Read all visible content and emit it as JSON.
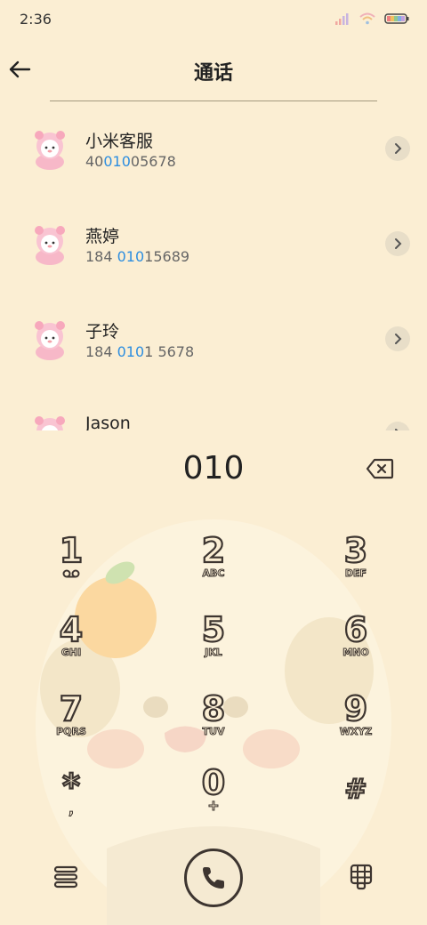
{
  "status": {
    "time": "2:36"
  },
  "header": {
    "title": "通话"
  },
  "contacts": [
    {
      "name": "小米客服",
      "num_pre": "40",
      "num_hl": "010",
      "num_post": "05678"
    },
    {
      "name": "燕婷",
      "num_pre": "184 ",
      "num_hl": "010",
      "num_post": "15689"
    },
    {
      "name": "子玲",
      "num_pre": "184 ",
      "num_hl": "010",
      "num_post": "1 5678"
    },
    {
      "name": "Jason",
      "num_pre": "",
      "num_hl": "",
      "num_post": ""
    }
  ],
  "dialer": {
    "input": "010",
    "keys": [
      {
        "digit": "1",
        "letters": ""
      },
      {
        "digit": "2",
        "letters": "ABC"
      },
      {
        "digit": "3",
        "letters": "DEF"
      },
      {
        "digit": "4",
        "letters": "GHI"
      },
      {
        "digit": "5",
        "letters": "JKL"
      },
      {
        "digit": "6",
        "letters": "MNO"
      },
      {
        "digit": "7",
        "letters": "PQRS"
      },
      {
        "digit": "8",
        "letters": "TUV"
      },
      {
        "digit": "9",
        "letters": "WXYZ"
      },
      {
        "digit": "*",
        "letters": ","
      },
      {
        "digit": "0",
        "letters": "+"
      },
      {
        "digit": "#",
        "letters": ""
      }
    ]
  },
  "colors": {
    "background": "#fbeed3",
    "highlight": "#2d8ee0",
    "ink": "#3d3530"
  }
}
